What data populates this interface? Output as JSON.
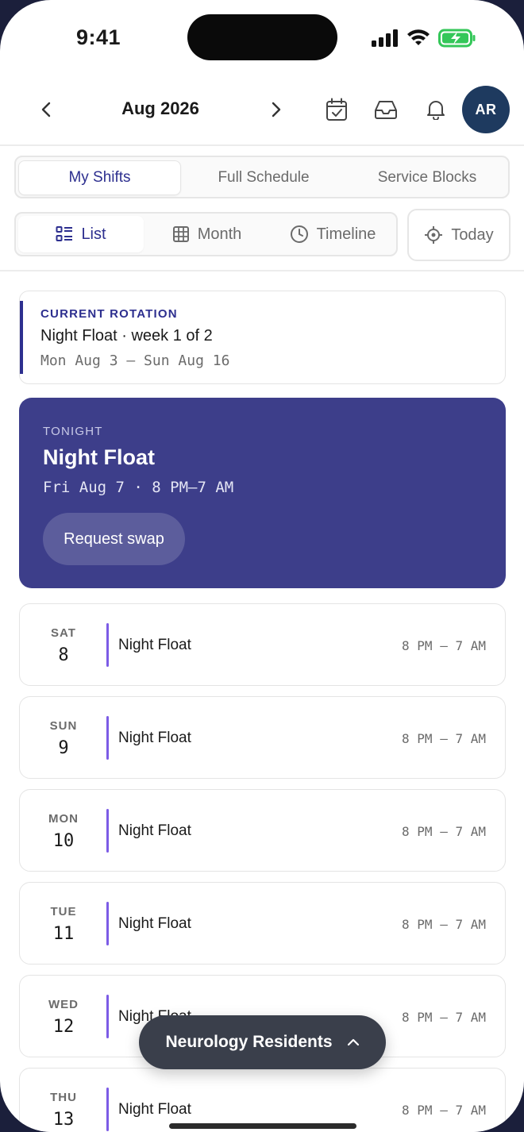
{
  "status_bar": {
    "time": "9:41"
  },
  "header": {
    "title": "Aug 2026",
    "avatar_initials": "AR",
    "avatar_color": "#1e3a5f"
  },
  "tabs": [
    {
      "label": "My Shifts",
      "active": true
    },
    {
      "label": "Full Schedule",
      "active": false
    },
    {
      "label": "Service Blocks",
      "active": false
    }
  ],
  "views": [
    {
      "label": "List",
      "icon": "list-icon",
      "active": true
    },
    {
      "label": "Month",
      "icon": "grid-icon",
      "active": false
    },
    {
      "label": "Timeline",
      "icon": "clock-icon",
      "active": false
    }
  ],
  "today_label": "Today",
  "rotation": {
    "label": "CURRENT ROTATION",
    "title": "Night Float · week 1 of 2",
    "dates": "Mon Aug 3 — Sun Aug 16"
  },
  "tonight": {
    "label": "TONIGHT",
    "title": "Night Float",
    "when": "Fri Aug 7 · 8 PM–7 AM",
    "button": "Request swap",
    "color": "#3d3e8a"
  },
  "shifts": [
    {
      "dow": "SAT",
      "day": "8",
      "name": "Night Float",
      "hours": "8 PM — 7 AM"
    },
    {
      "dow": "SUN",
      "day": "9",
      "name": "Night Float",
      "hours": "8 PM — 7 AM"
    },
    {
      "dow": "MON",
      "day": "10",
      "name": "Night Float",
      "hours": "8 PM — 7 AM"
    },
    {
      "dow": "TUE",
      "day": "11",
      "name": "Night Float",
      "hours": "8 PM — 7 AM"
    },
    {
      "dow": "WED",
      "day": "12",
      "name": "Night Float",
      "hours": "8 PM — 7 AM"
    },
    {
      "dow": "THU",
      "day": "13",
      "name": "Night Float",
      "hours": "8 PM — 7 AM"
    }
  ],
  "group_pill": {
    "label": "Neurology Residents"
  },
  "colors": {
    "accent": "#2d2f8f",
    "shift_accent": "#7c5ce6"
  }
}
